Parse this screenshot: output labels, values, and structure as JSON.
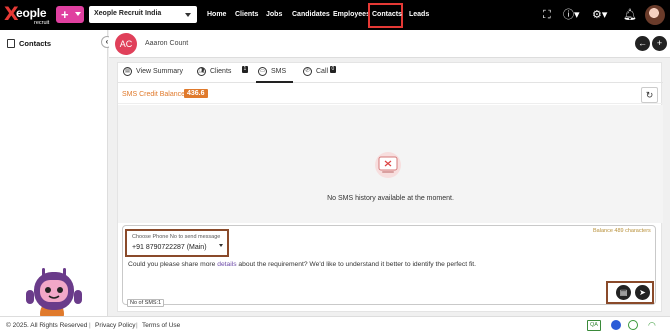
{
  "header": {
    "logo_text": "eople",
    "logo_sub": "recruit",
    "org": "Xeople Recruit India",
    "nav": [
      {
        "label": "Home"
      },
      {
        "label": "Clients"
      },
      {
        "label": "Jobs"
      },
      {
        "label": "Candidates"
      },
      {
        "label": "Employees"
      },
      {
        "label": "Contacts",
        "active": true
      },
      {
        "label": "Leads"
      }
    ]
  },
  "sidebar": {
    "items": [
      {
        "label": "Contacts"
      }
    ]
  },
  "contact": {
    "initials": "AC",
    "name": "Aaaron Count"
  },
  "tabs": [
    {
      "label": "View Summary"
    },
    {
      "label": "Clients",
      "badge": "1"
    },
    {
      "label": "SMS",
      "active": true
    },
    {
      "label": "Call",
      "badge": "0"
    }
  ],
  "sms": {
    "credit_label": "SMS Credit Balance:",
    "credit_value": "436.6",
    "empty_message": "No SMS history available at the moment.",
    "balance_chars": "Balance 489 characters",
    "phone_label": "Choose Phone No to send message",
    "phone_value": "+91 8790722287 (Main)",
    "message_pre": "Could you please share more ",
    "message_hl": "details",
    "message_post": " about the requirement? We'd like to understand it better to identify the perfect fit.",
    "count": "No of SMS:1"
  },
  "footer": {
    "copyright": "© 2025. All Rights Reserved",
    "privacy": "Privacy Policy",
    "terms": "Terms of Use",
    "env": "QA"
  },
  "colors": {
    "accent": "#e040a0",
    "credit": "#e07a2c",
    "highlight_border": "#8a4a2a",
    "nav_active_border": "#e53935"
  }
}
